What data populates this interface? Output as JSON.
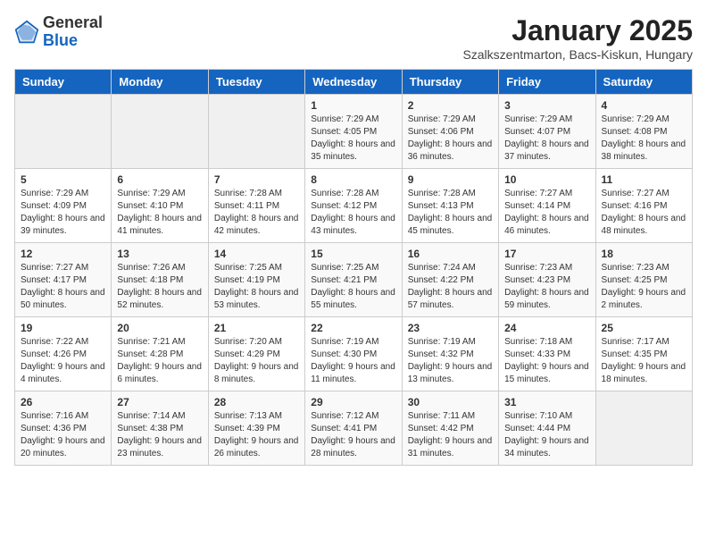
{
  "header": {
    "logo_general": "General",
    "logo_blue": "Blue",
    "month_title": "January 2025",
    "location": "Szalkszentmarton, Bacs-Kiskun, Hungary"
  },
  "weekdays": [
    "Sunday",
    "Monday",
    "Tuesday",
    "Wednesday",
    "Thursday",
    "Friday",
    "Saturday"
  ],
  "weeks": [
    [
      {
        "day": "",
        "info": ""
      },
      {
        "day": "",
        "info": ""
      },
      {
        "day": "",
        "info": ""
      },
      {
        "day": "1",
        "info": "Sunrise: 7:29 AM\nSunset: 4:05 PM\nDaylight: 8 hours and 35 minutes."
      },
      {
        "day": "2",
        "info": "Sunrise: 7:29 AM\nSunset: 4:06 PM\nDaylight: 8 hours and 36 minutes."
      },
      {
        "day": "3",
        "info": "Sunrise: 7:29 AM\nSunset: 4:07 PM\nDaylight: 8 hours and 37 minutes."
      },
      {
        "day": "4",
        "info": "Sunrise: 7:29 AM\nSunset: 4:08 PM\nDaylight: 8 hours and 38 minutes."
      }
    ],
    [
      {
        "day": "5",
        "info": "Sunrise: 7:29 AM\nSunset: 4:09 PM\nDaylight: 8 hours and 39 minutes."
      },
      {
        "day": "6",
        "info": "Sunrise: 7:29 AM\nSunset: 4:10 PM\nDaylight: 8 hours and 41 minutes."
      },
      {
        "day": "7",
        "info": "Sunrise: 7:28 AM\nSunset: 4:11 PM\nDaylight: 8 hours and 42 minutes."
      },
      {
        "day": "8",
        "info": "Sunrise: 7:28 AM\nSunset: 4:12 PM\nDaylight: 8 hours and 43 minutes."
      },
      {
        "day": "9",
        "info": "Sunrise: 7:28 AM\nSunset: 4:13 PM\nDaylight: 8 hours and 45 minutes."
      },
      {
        "day": "10",
        "info": "Sunrise: 7:27 AM\nSunset: 4:14 PM\nDaylight: 8 hours and 46 minutes."
      },
      {
        "day": "11",
        "info": "Sunrise: 7:27 AM\nSunset: 4:16 PM\nDaylight: 8 hours and 48 minutes."
      }
    ],
    [
      {
        "day": "12",
        "info": "Sunrise: 7:27 AM\nSunset: 4:17 PM\nDaylight: 8 hours and 50 minutes."
      },
      {
        "day": "13",
        "info": "Sunrise: 7:26 AM\nSunset: 4:18 PM\nDaylight: 8 hours and 52 minutes."
      },
      {
        "day": "14",
        "info": "Sunrise: 7:25 AM\nSunset: 4:19 PM\nDaylight: 8 hours and 53 minutes."
      },
      {
        "day": "15",
        "info": "Sunrise: 7:25 AM\nSunset: 4:21 PM\nDaylight: 8 hours and 55 minutes."
      },
      {
        "day": "16",
        "info": "Sunrise: 7:24 AM\nSunset: 4:22 PM\nDaylight: 8 hours and 57 minutes."
      },
      {
        "day": "17",
        "info": "Sunrise: 7:23 AM\nSunset: 4:23 PM\nDaylight: 8 hours and 59 minutes."
      },
      {
        "day": "18",
        "info": "Sunrise: 7:23 AM\nSunset: 4:25 PM\nDaylight: 9 hours and 2 minutes."
      }
    ],
    [
      {
        "day": "19",
        "info": "Sunrise: 7:22 AM\nSunset: 4:26 PM\nDaylight: 9 hours and 4 minutes."
      },
      {
        "day": "20",
        "info": "Sunrise: 7:21 AM\nSunset: 4:28 PM\nDaylight: 9 hours and 6 minutes."
      },
      {
        "day": "21",
        "info": "Sunrise: 7:20 AM\nSunset: 4:29 PM\nDaylight: 9 hours and 8 minutes."
      },
      {
        "day": "22",
        "info": "Sunrise: 7:19 AM\nSunset: 4:30 PM\nDaylight: 9 hours and 11 minutes."
      },
      {
        "day": "23",
        "info": "Sunrise: 7:19 AM\nSunset: 4:32 PM\nDaylight: 9 hours and 13 minutes."
      },
      {
        "day": "24",
        "info": "Sunrise: 7:18 AM\nSunset: 4:33 PM\nDaylight: 9 hours and 15 minutes."
      },
      {
        "day": "25",
        "info": "Sunrise: 7:17 AM\nSunset: 4:35 PM\nDaylight: 9 hours and 18 minutes."
      }
    ],
    [
      {
        "day": "26",
        "info": "Sunrise: 7:16 AM\nSunset: 4:36 PM\nDaylight: 9 hours and 20 minutes."
      },
      {
        "day": "27",
        "info": "Sunrise: 7:14 AM\nSunset: 4:38 PM\nDaylight: 9 hours and 23 minutes."
      },
      {
        "day": "28",
        "info": "Sunrise: 7:13 AM\nSunset: 4:39 PM\nDaylight: 9 hours and 26 minutes."
      },
      {
        "day": "29",
        "info": "Sunrise: 7:12 AM\nSunset: 4:41 PM\nDaylight: 9 hours and 28 minutes."
      },
      {
        "day": "30",
        "info": "Sunrise: 7:11 AM\nSunset: 4:42 PM\nDaylight: 9 hours and 31 minutes."
      },
      {
        "day": "31",
        "info": "Sunrise: 7:10 AM\nSunset: 4:44 PM\nDaylight: 9 hours and 34 minutes."
      },
      {
        "day": "",
        "info": ""
      }
    ]
  ]
}
